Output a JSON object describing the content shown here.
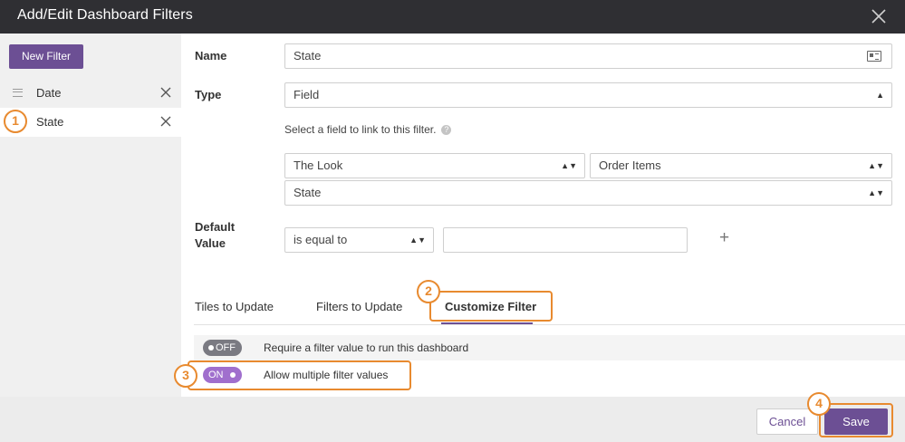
{
  "dialog": {
    "title": "Add/Edit Dashboard Filters"
  },
  "sidebar": {
    "new_filter_label": "New Filter",
    "items": [
      {
        "label": "Date"
      },
      {
        "label": "State"
      }
    ]
  },
  "form": {
    "name_label": "Name",
    "name_value": "State",
    "type_label": "Type",
    "type_value": "Field",
    "hint": "Select a field to link to this filter.",
    "model_value": "The Look",
    "explore_value": "Order Items",
    "field_value": "State",
    "default_label_line1": "Default",
    "default_label_line2": "Value",
    "operator_value": "is equal to",
    "default_input_value": ""
  },
  "tabs": [
    {
      "label": "Tiles to Update"
    },
    {
      "label": "Filters to Update"
    },
    {
      "label": "Customize Filter"
    }
  ],
  "options": [
    {
      "toggle": "OFF",
      "label": "Require a filter value to run this dashboard"
    },
    {
      "toggle": "ON",
      "label": "Allow multiple filter values"
    }
  ],
  "footer": {
    "cancel_label": "Cancel",
    "save_label": "Save"
  },
  "callouts": [
    "1",
    "2",
    "3",
    "4"
  ],
  "colors": {
    "accent": "#6c4f94",
    "toggle_on": "#a06fcd",
    "callout": "#e88a2f",
    "titlebar": "#2f2f33"
  }
}
